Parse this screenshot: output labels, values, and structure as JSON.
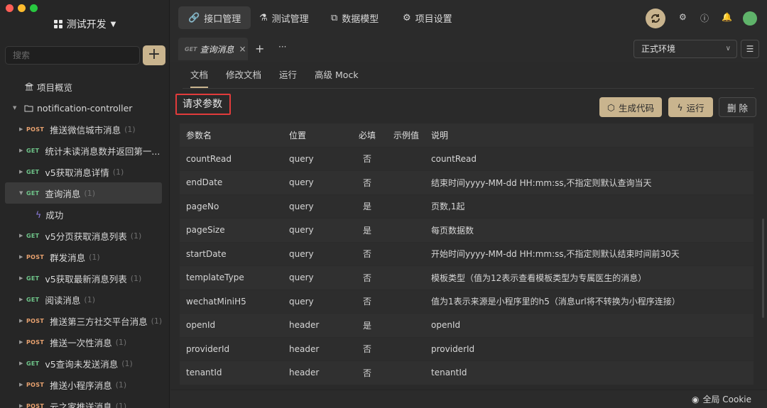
{
  "sidebar": {
    "project_title": "测试开发",
    "search_placeholder": "搜索",
    "overview": "项目概览",
    "folder": "notification-controller",
    "items": [
      {
        "method": "POST",
        "label": "推送微信城市消息",
        "count": "(1)"
      },
      {
        "method": "GET",
        "label": "统计未读消息数并返回第一...",
        "count": ""
      },
      {
        "method": "GET",
        "label": "v5获取消息详情",
        "count": "(1)"
      },
      {
        "method": "GET",
        "label": "查询消息",
        "count": "(1)",
        "active": true
      },
      {
        "method": "GET",
        "label": "v5分页获取消息列表",
        "count": "(1)"
      },
      {
        "method": "POST",
        "label": "群发消息",
        "count": "(1)"
      },
      {
        "method": "GET",
        "label": "v5获取最新消息列表",
        "count": "(1)"
      },
      {
        "method": "GET",
        "label": "阅读消息",
        "count": "(1)"
      },
      {
        "method": "POST",
        "label": "推送第三方社交平台消息",
        "count": "(1)"
      },
      {
        "method": "POST",
        "label": "推送一次性消息",
        "count": "(1)"
      },
      {
        "method": "GET",
        "label": "v5查询未发送消息",
        "count": "(1)"
      },
      {
        "method": "POST",
        "label": "推送小程序消息",
        "count": "(1)"
      },
      {
        "method": "POST",
        "label": "云之家推送消息",
        "count": "(1)"
      }
    ],
    "sub_item": "成功"
  },
  "topbar": {
    "tabs": [
      "接口管理",
      "测试管理",
      "数据模型",
      "项目设置"
    ]
  },
  "tabbar": {
    "file_tab_method": "GET",
    "file_tab_name": "查询消息",
    "environment": "正式环境"
  },
  "subtabs": [
    "文档",
    "修改文档",
    "运行",
    "高级 Mock"
  ],
  "section_title": "请求参数",
  "actions": {
    "gen_code": "生成代码",
    "run": "运行",
    "delete": "删 除"
  },
  "params": {
    "headers": [
      "参数名",
      "位置",
      "必填",
      "示例值",
      "说明"
    ],
    "rows": [
      [
        "countRead",
        "query",
        "否",
        "",
        "countRead"
      ],
      [
        "endDate",
        "query",
        "否",
        "",
        "结束时间yyyy-MM-dd HH:mm:ss,不指定则默认查询当天"
      ],
      [
        "pageNo",
        "query",
        "是",
        "",
        "页数,1起"
      ],
      [
        "pageSize",
        "query",
        "是",
        "",
        "每页数据数"
      ],
      [
        "startDate",
        "query",
        "否",
        "",
        "开始时间yyyy-MM-dd HH:mm:ss,不指定则默认结束时间前30天"
      ],
      [
        "templateType",
        "query",
        "否",
        "",
        "模板类型（值为12表示查看模板类型为专属医生的消息）"
      ],
      [
        "wechatMiniH5",
        "query",
        "否",
        "",
        "值为1表示来源是小程序里的h5（消息url将不转换为小程序连接）"
      ],
      [
        "openId",
        "header",
        "是",
        "",
        "openId"
      ],
      [
        "providerId",
        "header",
        "否",
        "",
        "providerId"
      ],
      [
        "tenantId",
        "header",
        "否",
        "",
        "tenantId"
      ]
    ]
  },
  "footer": {
    "cookie": "全局 Cookie"
  }
}
